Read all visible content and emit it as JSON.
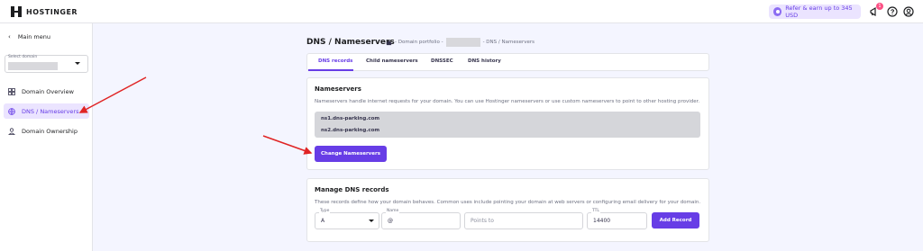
{
  "app": {
    "logo_text": "HOSTINGER"
  },
  "topbar": {
    "refer_label": "Refer & earn up to 345 USD",
    "notification_count": "1",
    "icons": [
      "megaphone-icon",
      "help-icon",
      "account-icon"
    ]
  },
  "sidebar": {
    "main_menu_label": "Main menu",
    "select_domain_label": "Select domain",
    "items": [
      {
        "label": "Domain Overview",
        "icon": "grid-icon"
      },
      {
        "label": "DNS / Nameservers",
        "icon": "globe-icon",
        "active": true
      },
      {
        "label": "Domain Ownership",
        "icon": "person-icon"
      }
    ]
  },
  "page": {
    "title": "DNS / Nameservers",
    "breadcrumb": {
      "first": "- Domain portfolio -",
      "last": "- DNS / Nameservers"
    }
  },
  "tabs": [
    {
      "label": "DNS records",
      "active": true
    },
    {
      "label": "Child nameservers"
    },
    {
      "label": "DNSSEC"
    },
    {
      "label": "DNS history"
    }
  ],
  "nameservers": {
    "title": "Nameservers",
    "description": "Nameservers handle internet requests for your domain. You can use Hostinger nameservers or use custom nameservers to point to other hosting provider.",
    "values": [
      "ns1.dns-parking.com",
      "ns2.dns-parking.com"
    ],
    "change_button": "Change Nameservers"
  },
  "dns_records": {
    "title": "Manage DNS records",
    "description": "These records define how your domain behaves. Common uses include pointing your domain at web servers or configuring email delivery for your domain.",
    "type": {
      "label": "Type",
      "value": "A"
    },
    "name": {
      "label": "Name",
      "value": "@"
    },
    "points_to": {
      "placeholder": "Points to"
    },
    "ttl": {
      "label": "TTL",
      "value": "14400"
    },
    "add_button": "Add Record"
  },
  "colors": {
    "accent": "#673de6",
    "arrow": "#e02424"
  }
}
